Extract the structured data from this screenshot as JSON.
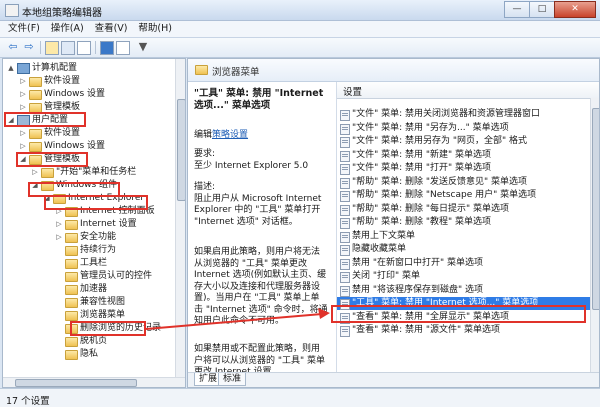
{
  "window": {
    "title": "本地组策略编辑器",
    "min_label": "—",
    "max_label": "□",
    "close_label": "✕"
  },
  "menu": [
    "文件(F)",
    "操作(A)",
    "查看(V)",
    "帮助(H)"
  ],
  "toolbar": {
    "back_label": "⇦",
    "forward_label": "⇨",
    "filter_label": "▼"
  },
  "tree": [
    {
      "label": "计算机配置",
      "indent": 1,
      "icon": "computer",
      "toggle": "▲"
    },
    {
      "label": "软件设置",
      "indent": 2,
      "icon": "folder",
      "toggle": "▷"
    },
    {
      "label": "Windows 设置",
      "indent": 2,
      "icon": "folder",
      "toggle": "▷"
    },
    {
      "label": "管理模板",
      "indent": 2,
      "icon": "folder",
      "toggle": "▷"
    },
    {
      "label": "用户配置",
      "indent": 1,
      "icon": "user",
      "toggle": "◢"
    },
    {
      "label": "软件设置",
      "indent": 2,
      "icon": "folder",
      "toggle": "▷"
    },
    {
      "label": "Windows 设置",
      "indent": 2,
      "icon": "folder",
      "toggle": "▷"
    },
    {
      "label": "管理模板",
      "indent": 2,
      "icon": "folder",
      "toggle": "◢"
    },
    {
      "label": "\"开始\"菜单和任务栏",
      "indent": 3,
      "icon": "folder",
      "toggle": "▷"
    },
    {
      "label": "Windows 组件",
      "indent": 3,
      "icon": "folder",
      "toggle": "◢"
    },
    {
      "label": "Internet Explorer",
      "indent": 4,
      "icon": "folder",
      "toggle": "◢"
    },
    {
      "label": "Internet 控制面板",
      "indent": 5,
      "icon": "folder",
      "toggle": "▷"
    },
    {
      "label": "Internet 设置",
      "indent": 5,
      "icon": "folder",
      "toggle": "▷"
    },
    {
      "label": "安全功能",
      "indent": 5,
      "icon": "folder",
      "toggle": "▷"
    },
    {
      "label": "持续行为",
      "indent": 5,
      "icon": "folder",
      "toggle": ""
    },
    {
      "label": "工具栏",
      "indent": 5,
      "icon": "folder",
      "toggle": ""
    },
    {
      "label": "管理员认可的控件",
      "indent": 5,
      "icon": "folder",
      "toggle": ""
    },
    {
      "label": "加速器",
      "indent": 5,
      "icon": "folder",
      "toggle": ""
    },
    {
      "label": "兼容性视图",
      "indent": 5,
      "icon": "folder",
      "toggle": ""
    },
    {
      "label": "浏览器菜单",
      "indent": 5,
      "icon": "folder",
      "toggle": ""
    },
    {
      "label": "删除浏览的历史记录",
      "indent": 5,
      "icon": "folder",
      "toggle": ""
    },
    {
      "label": "脱机页",
      "indent": 5,
      "icon": "folder",
      "toggle": ""
    },
    {
      "label": "隐私",
      "indent": 5,
      "icon": "folder",
      "toggle": ""
    }
  ],
  "right_header": "浏览器菜单",
  "description": {
    "title": "\"工具\" 菜单: 禁用 \"Internet 选项...\" 菜单选项",
    "edit_prefix": "编辑",
    "edit_link": "策略设置",
    "requirements": "要求:\n至少 Internet Explorer 5.0",
    "description": "描述:\n阻止用户从 Microsoft Internet Explorer 中的 \"工具\" 菜单打开 \"Internet 选项\" 对话框。",
    "enabled": "如果启用此策略，则用户将无法从浏览器的 \"工具\" 菜单更改 Internet 选项(例如默认主页、缓存大小以及连接和代理服务器设置)。当用户在 \"工具\" 菜单上单击 \"Internet 选项\" 命令时，将通知用户此命令不可用。",
    "disabled": "如果禁用或不配置此策略，则用户将可以从浏览器的 \"工具\" 菜单更改 Internet 设置。"
  },
  "list_header": "设置",
  "settings": [
    "\"文件\" 菜单: 禁用关闭浏览器和资源管理器窗口",
    "\"文件\" 菜单: 禁用 \"另存为...\" 菜单选项",
    "\"文件\" 菜单: 禁用另存为 \"网页，全部\" 格式",
    "\"文件\" 菜单: 禁用 \"新建\" 菜单选项",
    "\"文件\" 菜单: 禁用 \"打开\" 菜单选项",
    "\"帮助\" 菜单: 删除 \"发送反馈意见\" 菜单选项",
    "\"帮助\" 菜单: 删除 \"Netscape 用户\" 菜单选项",
    "\"帮助\" 菜单: 删除 \"每日提示\" 菜单选项",
    "\"帮助\" 菜单: 删除 \"教程\" 菜单选项",
    "禁用上下文菜单",
    "隐藏收藏菜单",
    "禁用 \"在新窗口中打开\" 菜单选项",
    "关闭 \"打印\" 菜单",
    "禁用 \"将该程序保存到磁盘\" 选项",
    "\"工具\" 菜单: 禁用 \"Internet 选项...\" 菜单选项",
    "\"查看\" 菜单: 禁用 \"全屏显示\" 菜单选项",
    "\"查看\" 菜单: 禁用 \"源文件\" 菜单选项"
  ],
  "selected_setting": 14,
  "tabs": [
    "扩展",
    "标准"
  ],
  "status": "17 个设置",
  "colors": {
    "highlight": "#e0322a",
    "selection": "#2f7ce6"
  }
}
